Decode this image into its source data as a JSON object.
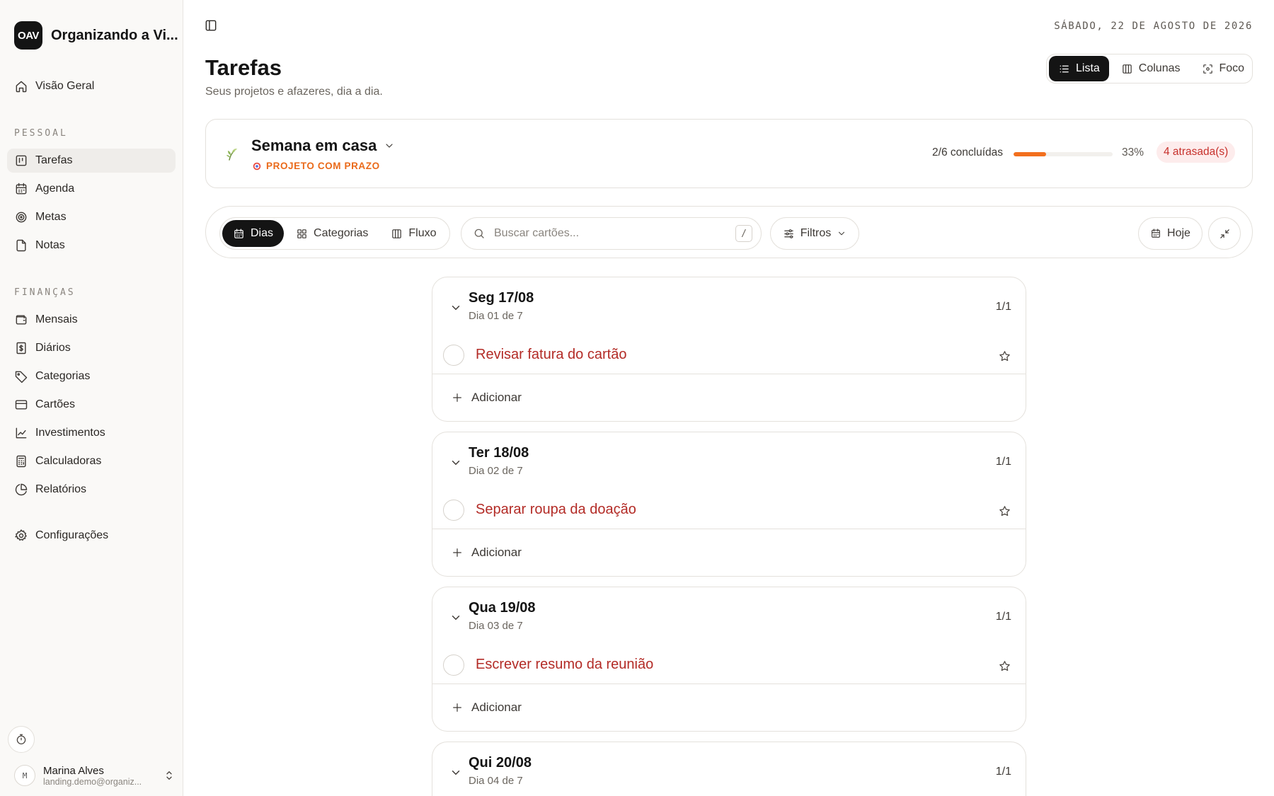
{
  "app": {
    "logo_text": "OAV",
    "name": "Organizando a Vi..."
  },
  "sidebar": {
    "overview": "Visão Geral",
    "sections": [
      {
        "title": "PESSOAL",
        "items": [
          "Tarefas",
          "Agenda",
          "Metas",
          "Notas"
        ]
      },
      {
        "title": "FINANÇAS",
        "items": [
          "Mensais",
          "Diários",
          "Categorias",
          "Cartões",
          "Investimentos",
          "Calculadoras",
          "Relatórios"
        ]
      }
    ],
    "settings": "Configurações",
    "active_item": "Tarefas"
  },
  "user": {
    "initial": "M",
    "name": "Marina Alves",
    "email": "landing.demo@organiz..."
  },
  "header": {
    "date": "SÁBADO, 22 DE AGOSTO DE 2026",
    "title": "Tarefas",
    "subtitle": "Seus projetos e afazeres, dia a dia.",
    "views": [
      "Lista",
      "Colunas",
      "Foco"
    ],
    "active_view": "Lista"
  },
  "project": {
    "name": "Semana em casa",
    "tag": "PROJETO COM PRAZO",
    "progress_text": "2/6 concluídas",
    "progress_fraction": 0.33,
    "percent": "33%",
    "late": "4 atrasada(s)"
  },
  "toolbar": {
    "modes": [
      "Dias",
      "Categorias",
      "Fluxo"
    ],
    "active_mode": "Dias",
    "search_placeholder": "Buscar cartões...",
    "search_shortcut": "/",
    "filters": "Filtros",
    "today": "Hoje"
  },
  "days": [
    {
      "title": "Seg 17/08",
      "subtitle": "Dia 01 de 7",
      "count": "1/1",
      "task": "Revisar fatura do cartão",
      "add": "Adicionar"
    },
    {
      "title": "Ter 18/08",
      "subtitle": "Dia 02 de 7",
      "count": "1/1",
      "task": "Separar roupa da doação",
      "add": "Adicionar"
    },
    {
      "title": "Qua 19/08",
      "subtitle": "Dia 03 de 7",
      "count": "1/1",
      "task": "Escrever resumo da reunião",
      "add": "Adicionar"
    },
    {
      "title": "Qui 20/08",
      "subtitle": "Dia 04 de 7",
      "count": "1/1"
    }
  ],
  "colors": {
    "accent": "#141414",
    "progress": "#f26f1d",
    "late_text": "#c7302b",
    "late_bg": "#fdecec",
    "task_text": "#b32b26",
    "tag": "#ea6a1a"
  }
}
